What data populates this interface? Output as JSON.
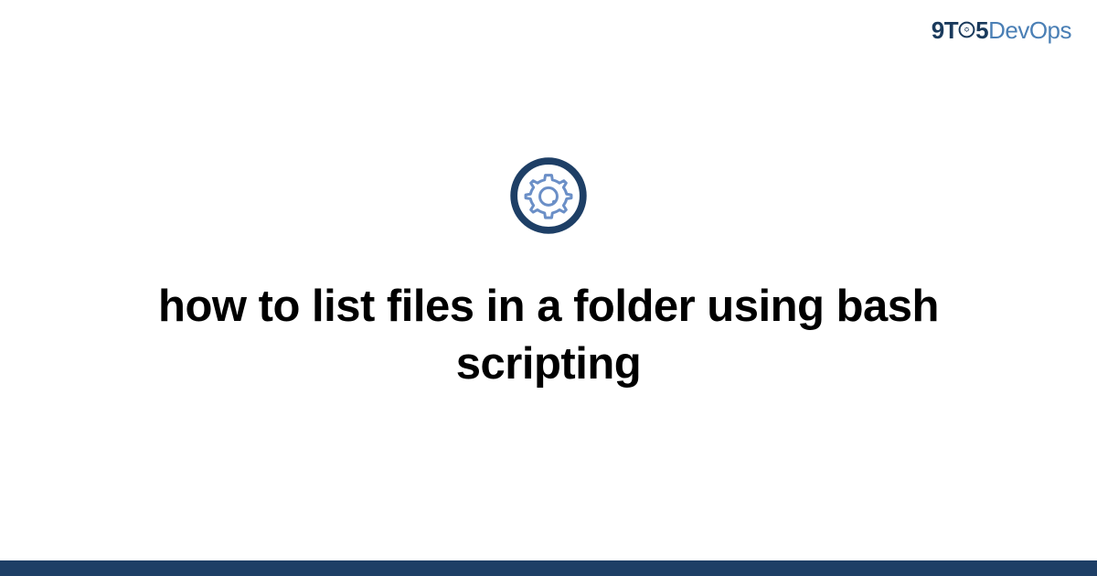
{
  "logo": {
    "part1": "9",
    "part2": "T",
    "part3": "5",
    "part4": "DevOps"
  },
  "title": "how to list files in a folder using bash scripting",
  "colors": {
    "logo_dark": "#1a3a5c",
    "logo_light": "#4a7fb5",
    "icon_ring": "#1e3f66",
    "icon_gear": "#6b8fc7",
    "bottom_bar": "#1e3f66"
  }
}
